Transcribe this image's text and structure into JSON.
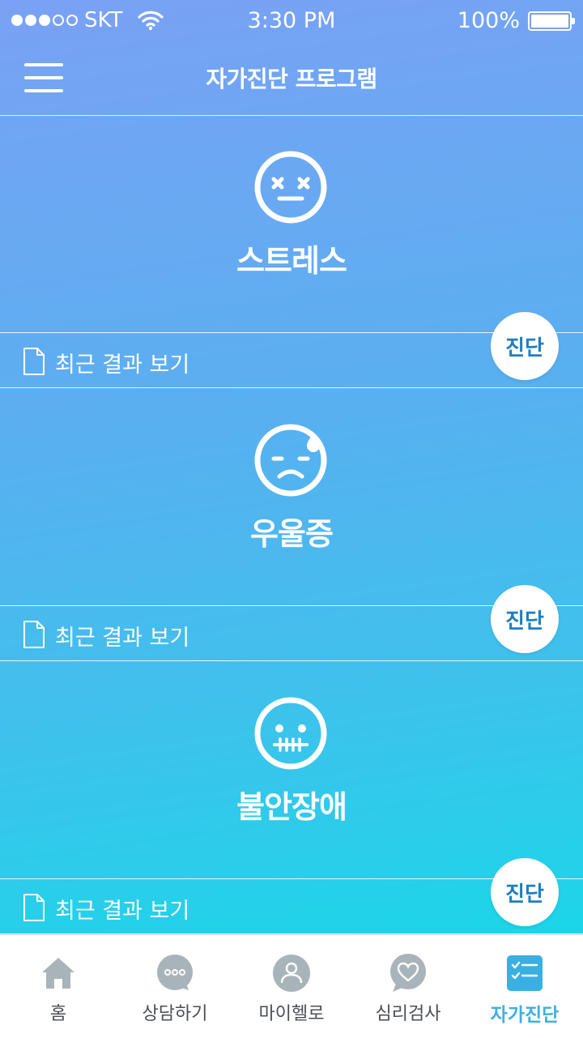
{
  "status_bar": {
    "carrier": "SKT",
    "time": "3:30 PM",
    "battery": "100%",
    "signal_bars": 3
  },
  "header": {
    "title": "자가진단 프로그램",
    "menu_icon": "hamburger-icon"
  },
  "sections": [
    {
      "title": "스트레스",
      "icon": "dizzy-face-icon",
      "result_label": "최근 결과 보기",
      "button_label": "진단"
    },
    {
      "title": "우울증",
      "icon": "sad-sweat-face-icon",
      "result_label": "최근 결과 보기",
      "button_label": "진단"
    },
    {
      "title": "불안장애",
      "icon": "grimace-face-icon",
      "result_label": "최근 결과 보기",
      "button_label": "진단"
    }
  ],
  "tabs": [
    {
      "label": "홈",
      "icon": "home-icon"
    },
    {
      "label": "상담하기",
      "icon": "chat-bubble-icon"
    },
    {
      "label": "마이헬로",
      "icon": "user-icon"
    },
    {
      "label": "심리검사",
      "icon": "heart-bubble-icon"
    },
    {
      "label": "자가진단",
      "icon": "checklist-icon",
      "active": true
    }
  ],
  "colors": {
    "accent": "#3ab0e2",
    "button_text": "#1f7fbf",
    "tab_icon": "#a9b4ba",
    "gradient_top": "#7aa1f5",
    "gradient_bottom": "#1bd6e8"
  }
}
